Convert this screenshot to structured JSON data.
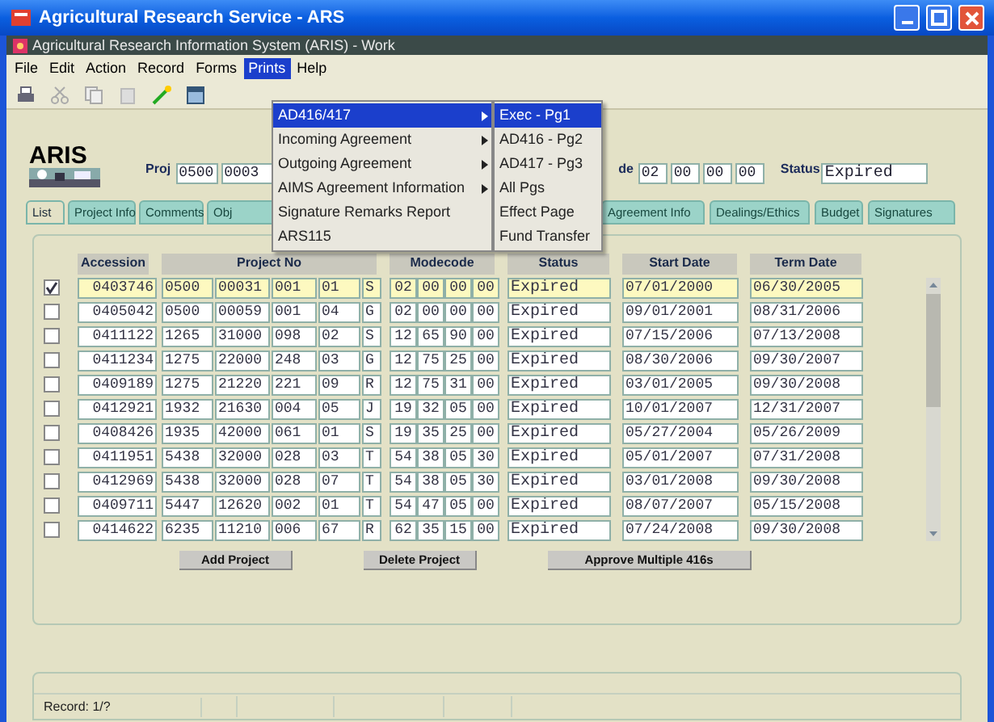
{
  "window": {
    "title": "Agricultural Research Service - ARS"
  },
  "inner_window": {
    "title": "Agricultural Research Information System (ARIS) - Work"
  },
  "menu_bar": [
    {
      "label": "File",
      "selected": false
    },
    {
      "label": "Edit",
      "selected": false
    },
    {
      "label": "Action",
      "selected": false
    },
    {
      "label": "Record",
      "selected": false
    },
    {
      "label": "Forms",
      "selected": false
    },
    {
      "label": "Prints",
      "selected": true
    },
    {
      "label": "Help",
      "selected": false
    }
  ],
  "prints_menu": [
    {
      "label": "AD416/417",
      "submenu": true,
      "selected": true
    },
    {
      "label": "Incoming Agreement",
      "submenu": true,
      "selected": false
    },
    {
      "label": "Outgoing Agreement",
      "submenu": true,
      "selected": false
    },
    {
      "label": "AIMS Agreement Information",
      "submenu": true,
      "selected": false
    },
    {
      "label": "Signature Remarks Report",
      "submenu": false,
      "selected": false
    },
    {
      "label": "ARS115",
      "submenu": false,
      "selected": false
    }
  ],
  "submenu": [
    {
      "label": "Exec - Pg1",
      "selected": true
    },
    {
      "label": "AD416 - Pg2",
      "selected": false
    },
    {
      "label": "AD417 - Pg3",
      "selected": false
    },
    {
      "label": "All Pgs",
      "selected": false
    },
    {
      "label": "Effect Page",
      "selected": false
    },
    {
      "label": "Fund Transfer",
      "selected": false
    }
  ],
  "header": {
    "logo": "ARIS",
    "proj_label": "Proj",
    "proj_fields": [
      "0500",
      "0003"
    ],
    "modecode_label": "de",
    "modecode_fields": [
      "02",
      "00",
      "00",
      "00"
    ],
    "status_label": "Status",
    "status_value": "Expired"
  },
  "tabs": [
    {
      "label": "List",
      "selected": true
    },
    {
      "label": "Project Info",
      "selected": false
    },
    {
      "label": "Comments",
      "selected": false
    },
    {
      "label": "Obj",
      "selected": false
    },
    {
      "label": "Agreement Info",
      "selected": false
    },
    {
      "label": "Dealings/Ethics",
      "selected": false
    },
    {
      "label": "Budget",
      "selected": false
    },
    {
      "label": "Signatures",
      "selected": false
    }
  ],
  "table": {
    "columns": [
      "Accession",
      "Project No",
      "Modecode",
      "Status",
      "Start Date",
      "Term Date"
    ],
    "rows": [
      {
        "checked": true,
        "selected": true,
        "accession": "0403746",
        "project": [
          "0500",
          "00031",
          "001",
          "01",
          "S"
        ],
        "modecode": [
          "02",
          "00",
          "00",
          "00"
        ],
        "status": "Expired",
        "start": "07/01/2000",
        "term": "06/30/2005"
      },
      {
        "checked": false,
        "selected": false,
        "accession": "0405042",
        "project": [
          "0500",
          "00059",
          "001",
          "04",
          "G"
        ],
        "modecode": [
          "02",
          "00",
          "00",
          "00"
        ],
        "status": "Expired",
        "start": "09/01/2001",
        "term": "08/31/2006"
      },
      {
        "checked": false,
        "selected": false,
        "accession": "0411122",
        "project": [
          "1265",
          "31000",
          "098",
          "02",
          "S"
        ],
        "modecode": [
          "12",
          "65",
          "90",
          "00"
        ],
        "status": "Expired",
        "start": "07/15/2006",
        "term": "07/13/2008"
      },
      {
        "checked": false,
        "selected": false,
        "accession": "0411234",
        "project": [
          "1275",
          "22000",
          "248",
          "03",
          "G"
        ],
        "modecode": [
          "12",
          "75",
          "25",
          "00"
        ],
        "status": "Expired",
        "start": "08/30/2006",
        "term": "09/30/2007"
      },
      {
        "checked": false,
        "selected": false,
        "accession": "0409189",
        "project": [
          "1275",
          "21220",
          "221",
          "09",
          "R"
        ],
        "modecode": [
          "12",
          "75",
          "31",
          "00"
        ],
        "status": "Expired",
        "start": "03/01/2005",
        "term": "09/30/2008"
      },
      {
        "checked": false,
        "selected": false,
        "accession": "0412921",
        "project": [
          "1932",
          "21630",
          "004",
          "05",
          "J"
        ],
        "modecode": [
          "19",
          "32",
          "05",
          "00"
        ],
        "status": "Expired",
        "start": "10/01/2007",
        "term": "12/31/2007"
      },
      {
        "checked": false,
        "selected": false,
        "accession": "0408426",
        "project": [
          "1935",
          "42000",
          "061",
          "01",
          "S"
        ],
        "modecode": [
          "19",
          "35",
          "25",
          "00"
        ],
        "status": "Expired",
        "start": "05/27/2004",
        "term": "05/26/2009"
      },
      {
        "checked": false,
        "selected": false,
        "accession": "0411951",
        "project": [
          "5438",
          "32000",
          "028",
          "03",
          "T"
        ],
        "modecode": [
          "54",
          "38",
          "05",
          "30"
        ],
        "status": "Expired",
        "start": "05/01/2007",
        "term": "07/31/2008"
      },
      {
        "checked": false,
        "selected": false,
        "accession": "0412969",
        "project": [
          "5438",
          "32000",
          "028",
          "07",
          "T"
        ],
        "modecode": [
          "54",
          "38",
          "05",
          "30"
        ],
        "status": "Expired",
        "start": "03/01/2008",
        "term": "09/30/2008"
      },
      {
        "checked": false,
        "selected": false,
        "accession": "0409711",
        "project": [
          "5447",
          "12620",
          "002",
          "01",
          "T"
        ],
        "modecode": [
          "54",
          "47",
          "05",
          "00"
        ],
        "status": "Expired",
        "start": "08/07/2007",
        "term": "05/15/2008"
      },
      {
        "checked": false,
        "selected": false,
        "accession": "0414622",
        "project": [
          "6235",
          "11210",
          "006",
          "67",
          "R"
        ],
        "modecode": [
          "62",
          "35",
          "15",
          "00"
        ],
        "status": "Expired",
        "start": "07/24/2008",
        "term": "09/30/2008"
      }
    ]
  },
  "buttons": [
    "Add Project",
    "Delete Project",
    "Approve Multiple 416s"
  ],
  "status_bar": {
    "record": "Record: 1/?"
  }
}
